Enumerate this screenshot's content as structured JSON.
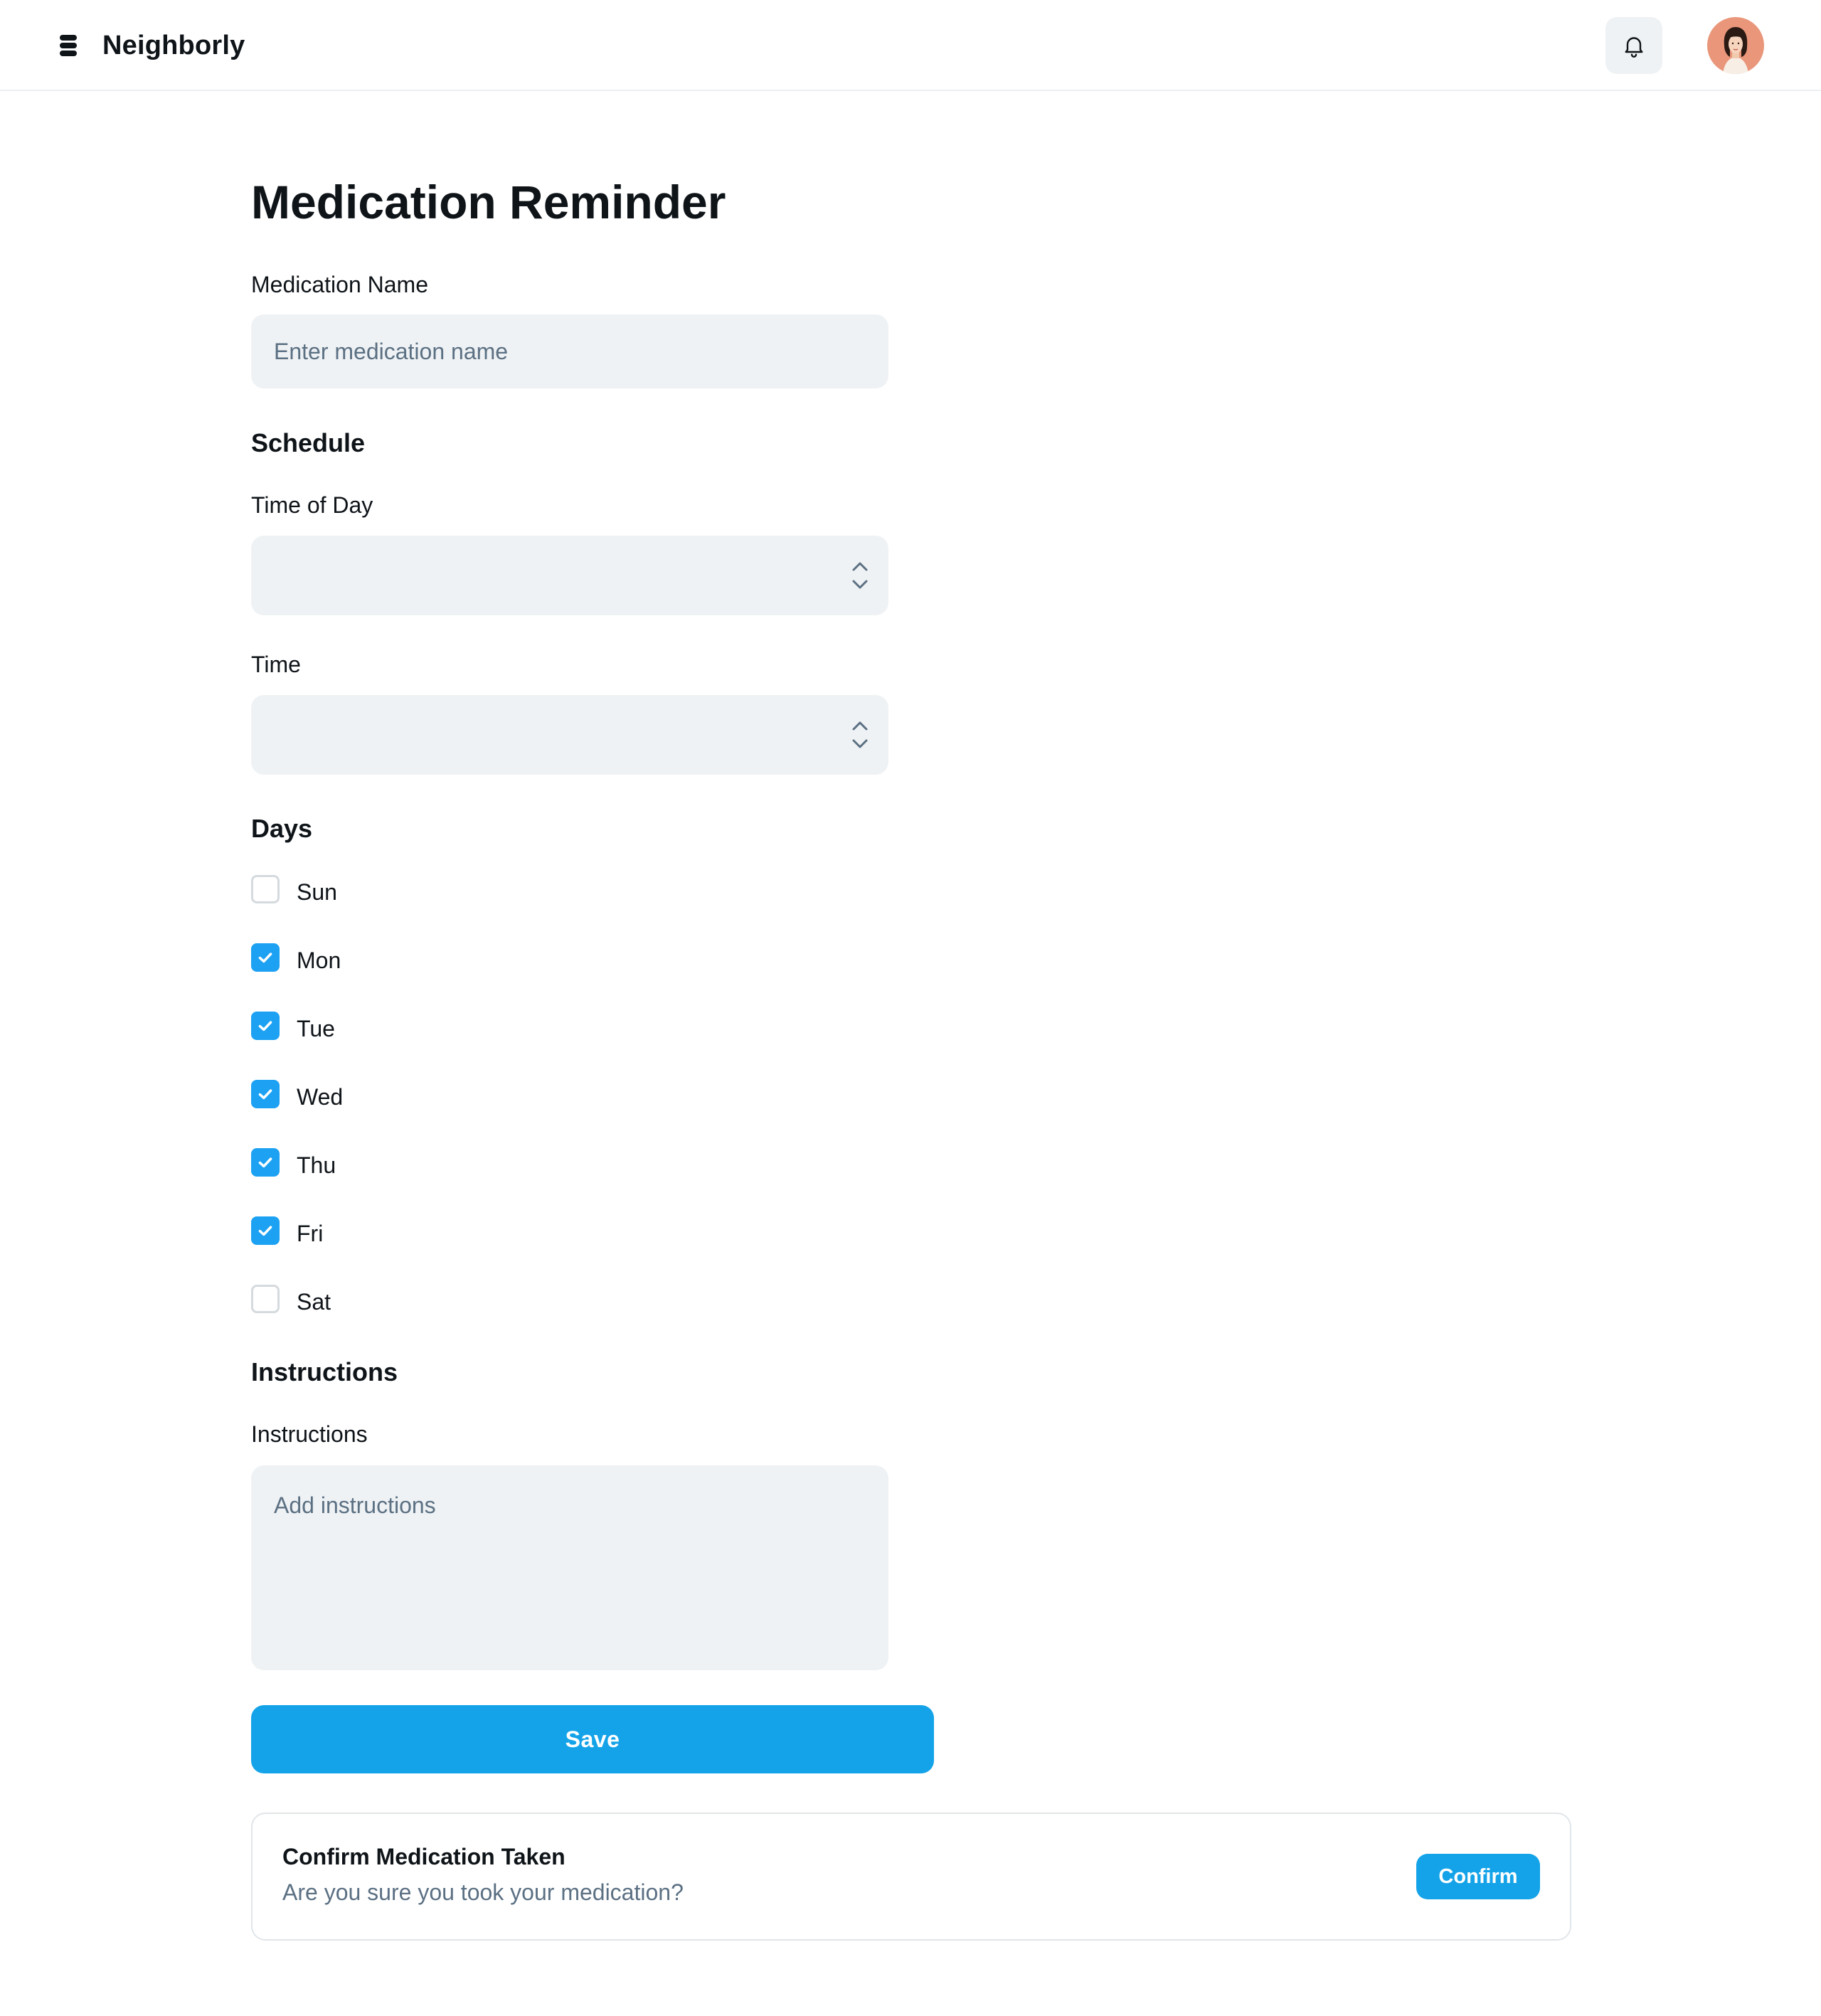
{
  "app": {
    "name": "Neighborly",
    "logo_icon": "stack-logo-icon",
    "notification_icon": "bell-icon",
    "avatar_icon": "user-avatar"
  },
  "page": {
    "title": "Medication Reminder"
  },
  "form": {
    "medication_name": {
      "label": "Medication Name",
      "value": "",
      "placeholder": "Enter medication name"
    },
    "schedule": {
      "heading": "Schedule",
      "time_of_day": {
        "label": "Time of Day",
        "value": ""
      },
      "time": {
        "label": "Time",
        "value": ""
      }
    },
    "days": {
      "heading": "Days",
      "items": [
        {
          "label": "Sun",
          "checked": false
        },
        {
          "label": "Mon",
          "checked": true
        },
        {
          "label": "Tue",
          "checked": true
        },
        {
          "label": "Wed",
          "checked": true
        },
        {
          "label": "Thu",
          "checked": true
        },
        {
          "label": "Fri",
          "checked": true
        },
        {
          "label": "Sat",
          "checked": false
        }
      ]
    },
    "instructions": {
      "heading": "Instructions",
      "label": "Instructions",
      "value": "",
      "placeholder": "Add instructions"
    },
    "save_label": "Save"
  },
  "confirm": {
    "title": "Confirm Medication Taken",
    "message": "Are you sure you took your medication?",
    "button_label": "Confirm"
  },
  "colors": {
    "accent": "#14a3e8",
    "field_bg": "#eff2f4",
    "text": "#0f1419",
    "muted": "#5b7083"
  }
}
